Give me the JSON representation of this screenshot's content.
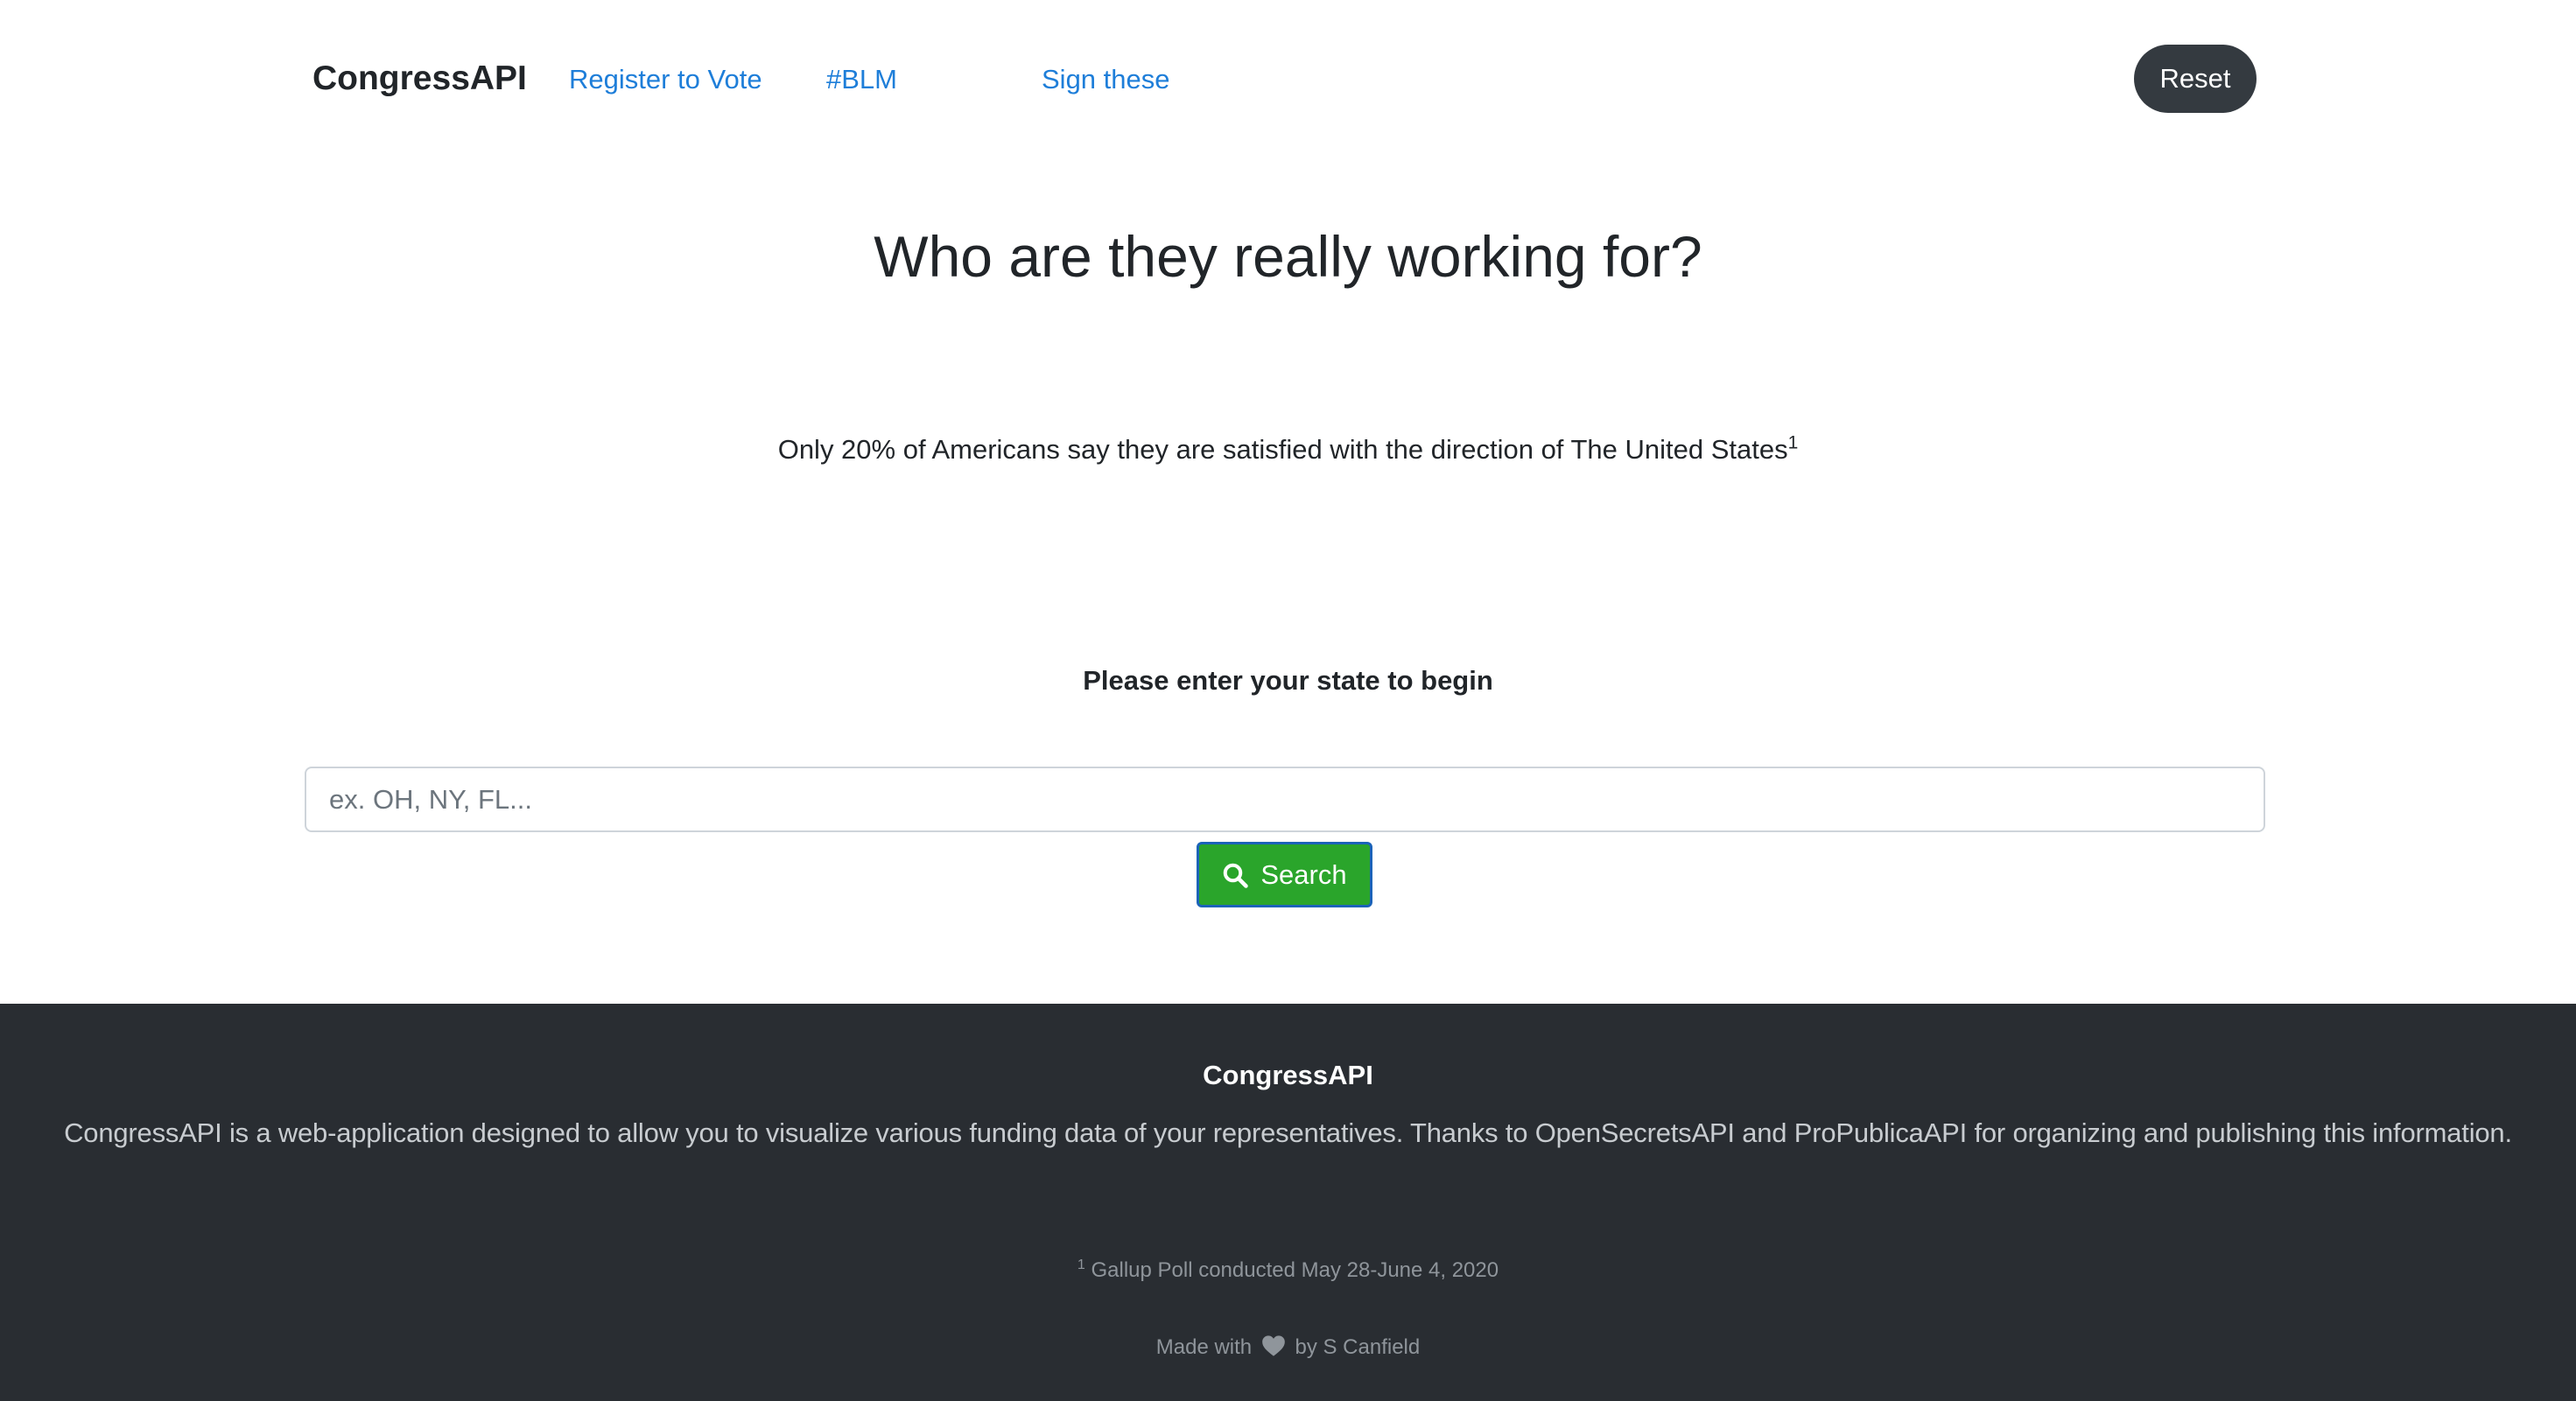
{
  "navbar": {
    "brand": "CongressAPI",
    "links": [
      {
        "label": "Register to Vote"
      },
      {
        "label": "#BLM"
      },
      {
        "label": "Sign these"
      }
    ],
    "reset_label": "Reset"
  },
  "main": {
    "title": "Who are they really working for?",
    "stat_text": "Only 20% of Americans say they are satisfied with the direction of The United States",
    "stat_footnote_marker": "1",
    "prompt": "Please enter your state to begin",
    "search": {
      "placeholder": "ex. OH, NY, FL...",
      "value": "",
      "button_label": "Search",
      "button_icon": "search-icon"
    }
  },
  "footer": {
    "title": "CongressAPI",
    "description": "CongressAPI is a web-application designed to allow you to visualize various funding data of your representatives. Thanks to OpenSecretsAPI and ProPublicaAPI for organizing and publishing this information.",
    "footnote_marker": "1",
    "footnote_text": "Gallup Poll conducted May 28-June 4, 2020",
    "made_with_prefix": "Made with",
    "made_with_icon": "heart-icon",
    "made_with_suffix": "by S Canfield"
  },
  "colors": {
    "link": "#1e7ed9",
    "reset_button": "#343a40",
    "search_button": "#2aa52b",
    "search_button_border": "#1b63b8",
    "footer_background": "#292d32"
  }
}
